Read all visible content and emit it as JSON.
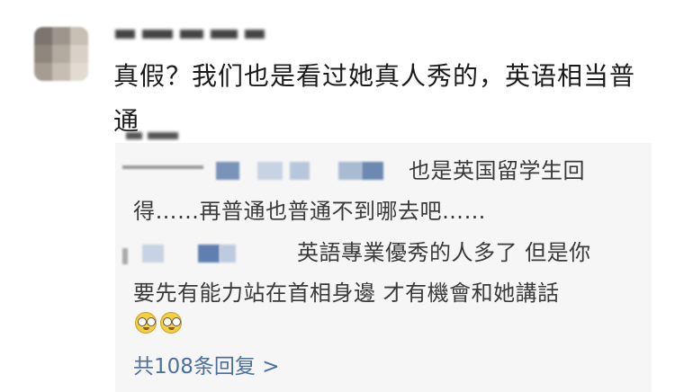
{
  "comment": {
    "text": "真假？我们也是看过她真人秀的，英语相当普通"
  },
  "replies": [
    {
      "line1": "也是英国留学生回",
      "line2": "得……再普通也普通不到哪去吧……"
    },
    {
      "line1": "英語專業優秀的人多了 但是你",
      "line2": "要先有能力站在首相身邊 才有機會和她講話"
    }
  ],
  "emoji": [
    "glasses-face-emoji",
    "glasses-face-emoji"
  ],
  "more_replies": {
    "label": "共108条回复 >"
  },
  "colors": {
    "reply_background": "#f6f6f6",
    "link": "#4d6fa0"
  }
}
